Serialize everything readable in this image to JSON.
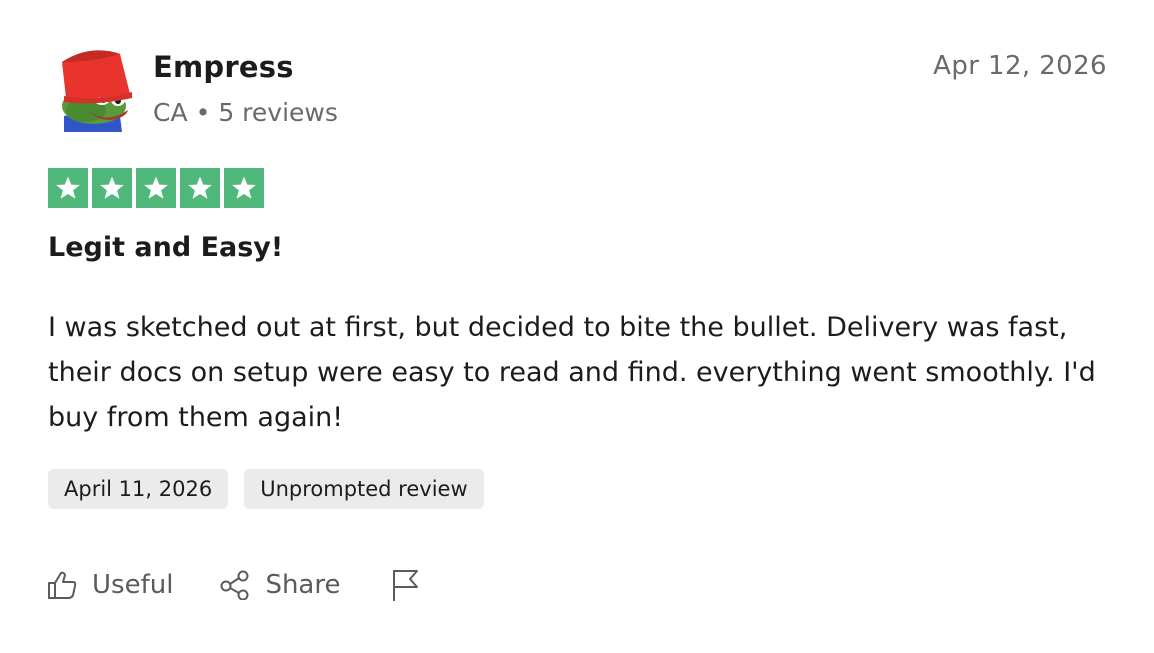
{
  "review": {
    "reviewer": {
      "name": "Empress",
      "country": "CA",
      "reviews_count": "5 reviews",
      "avatar_icon": "frog-with-red-bucket-hat-icon"
    },
    "posted_date": "Apr 12, 2026",
    "rating": 5,
    "rating_max": 5,
    "rating_color": "#4fb87a",
    "title": "Legit and Easy!",
    "body": "I was sketched out at first, but decided to bite the bullet. Delivery was fast, their docs on setup were easy to read and find. everything went smoothly. I'd buy from them again!",
    "tags": {
      "experience_date": "April 11, 2026",
      "review_type": "Unprompted review"
    },
    "actions": {
      "useful_label": "Useful",
      "share_label": "Share",
      "useful_icon": "thumbs-up-icon",
      "share_icon": "share-icon",
      "report_icon": "flag-icon"
    }
  }
}
